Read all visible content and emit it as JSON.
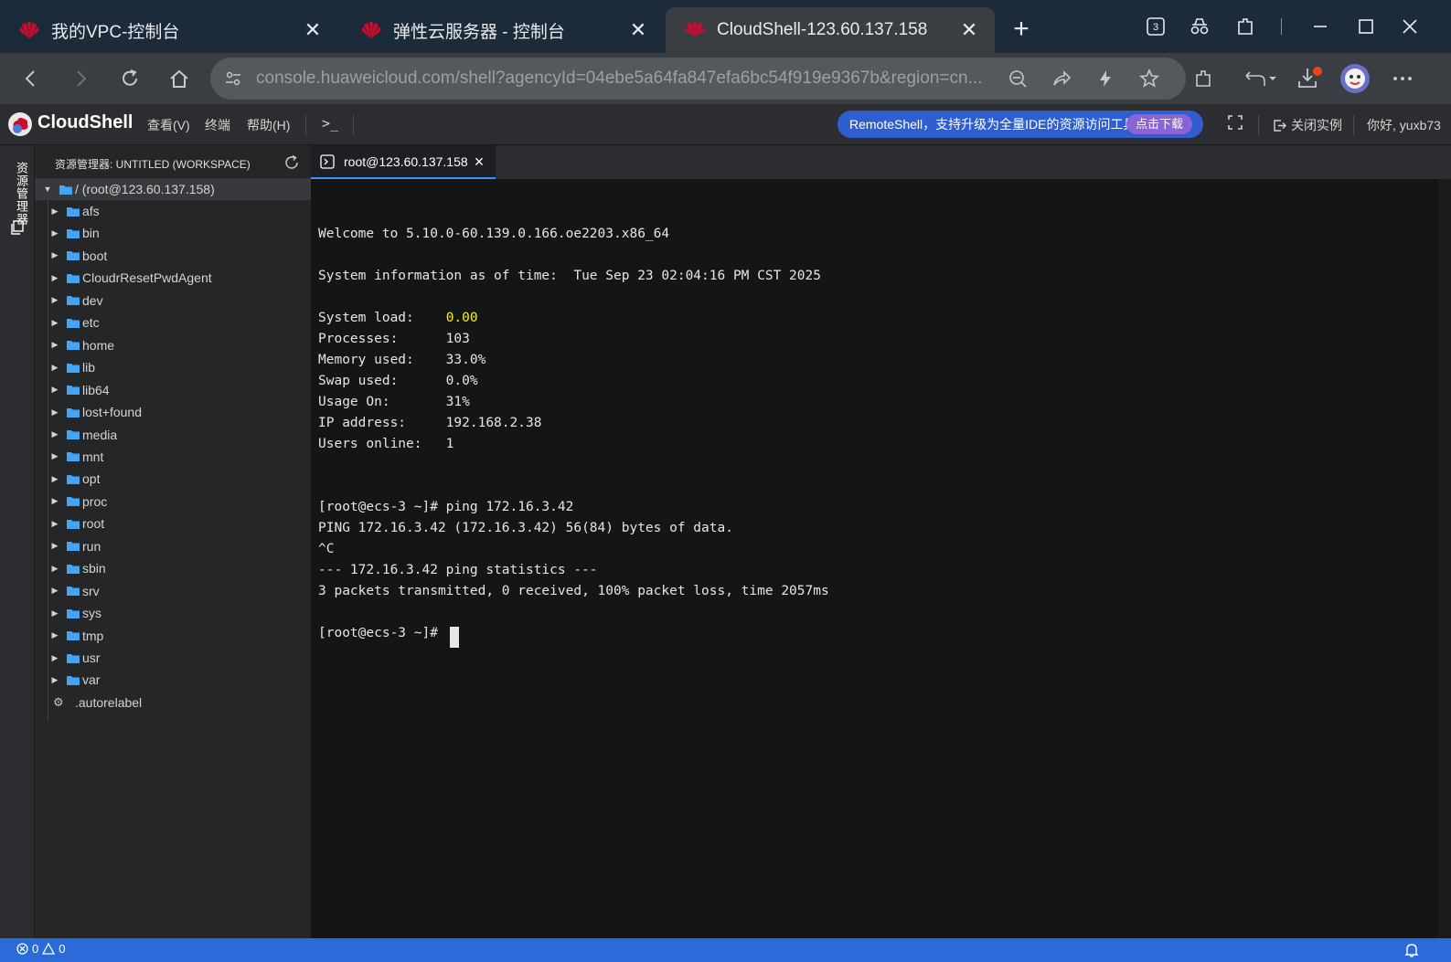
{
  "browser": {
    "tabs": [
      {
        "title": "我的VPC-控制台",
        "active": false
      },
      {
        "title": "弹性云服务器 - 控制台",
        "active": false
      },
      {
        "title": "CloudShell-123.60.137.158",
        "active": true
      }
    ],
    "new_tab_symbol": "+",
    "tab_count_badge": "3",
    "address": "console.huaweicloud.com/shell?agencyId=04ebe5a64fa847efa6bc54f919e9367b&region=cn..."
  },
  "cloudshell": {
    "brand": "CloudShell",
    "menu": [
      "查看(V)",
      "终端",
      "帮助(H)"
    ],
    "terminal_icon": ">_",
    "promo_text": "RemoteShell，支持升级为全量IDE的资源访问工具",
    "promo_button": "点击下载",
    "close_instance": "关闭实例",
    "greeting": "你好, yuxb73"
  },
  "activity": {
    "explorer_label": "资源管理器"
  },
  "explorer": {
    "title": "资源管理器: UNTITLED (WORKSPACE)",
    "root_label": "/ (root@123.60.137.158)",
    "folders": [
      "afs",
      "bin",
      "boot",
      "CloudrResetPwdAgent",
      "dev",
      "etc",
      "home",
      "lib",
      "lib64",
      "lost+found",
      "media",
      "mnt",
      "opt",
      "proc",
      "root",
      "run",
      "sbin",
      "srv",
      "sys",
      "tmp",
      "usr",
      "var"
    ],
    "files": [
      ".autorelabel"
    ]
  },
  "editor": {
    "tab_label": "root@123.60.137.158"
  },
  "terminal": {
    "welcome": "Welcome to 5.10.0-60.139.0.166.oe2203.x86_64",
    "sysinfo": "System information as of time:  Tue Sep 23 02:04:16 PM CST 2025",
    "load_label": "System load:    ",
    "load_value": "0.00",
    "processes": "Processes:      103",
    "memory": "Memory used:    33.0%",
    "swap": "Swap used:      0.0%",
    "usage": "Usage On:       31%",
    "ip": "IP address:     192.168.2.38",
    "users": "Users online:   1",
    "cmd_ping": "[root@ecs-3 ~]# ping 172.16.3.42",
    "ping_header": "PING 172.16.3.42 (172.16.3.42) 56(84) bytes of data.",
    "ctrl_c": "^C",
    "stats_header": "--- 172.16.3.42 ping statistics ---",
    "stats": "3 packets transmitted, 0 received, 100% packet loss, time 2057ms",
    "prompt": "[root@ecs-3 ~]# "
  },
  "status": {
    "errors": "0",
    "warnings": "0"
  },
  "colors": {
    "accent_blue": "#2a6ad9",
    "highlight_yellow": "#f2f20a",
    "folder_blue": "#42a5f5",
    "huawei_red": "#cf0a2c"
  }
}
